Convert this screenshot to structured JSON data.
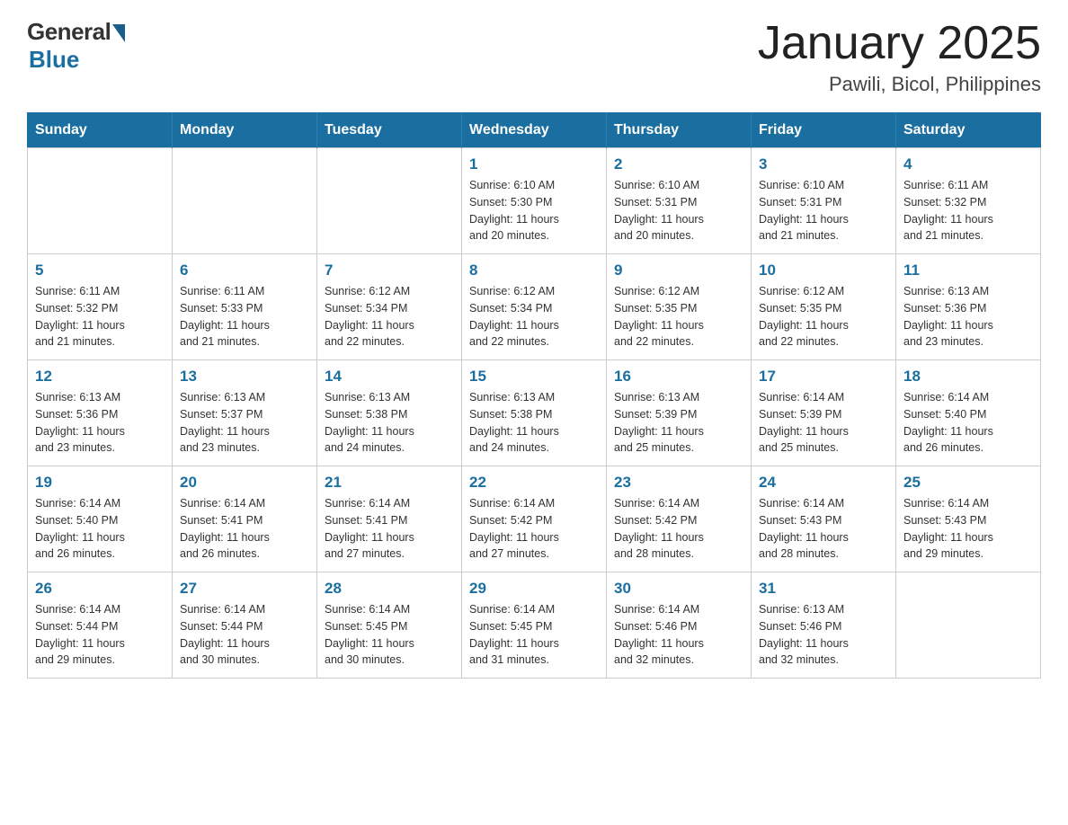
{
  "logo": {
    "general": "General",
    "blue": "Blue"
  },
  "title": "January 2025",
  "subtitle": "Pawili, Bicol, Philippines",
  "days_of_week": [
    "Sunday",
    "Monday",
    "Tuesday",
    "Wednesday",
    "Thursday",
    "Friday",
    "Saturday"
  ],
  "weeks": [
    [
      {
        "day": "",
        "info": ""
      },
      {
        "day": "",
        "info": ""
      },
      {
        "day": "",
        "info": ""
      },
      {
        "day": "1",
        "info": "Sunrise: 6:10 AM\nSunset: 5:30 PM\nDaylight: 11 hours\nand 20 minutes."
      },
      {
        "day": "2",
        "info": "Sunrise: 6:10 AM\nSunset: 5:31 PM\nDaylight: 11 hours\nand 20 minutes."
      },
      {
        "day": "3",
        "info": "Sunrise: 6:10 AM\nSunset: 5:31 PM\nDaylight: 11 hours\nand 21 minutes."
      },
      {
        "day": "4",
        "info": "Sunrise: 6:11 AM\nSunset: 5:32 PM\nDaylight: 11 hours\nand 21 minutes."
      }
    ],
    [
      {
        "day": "5",
        "info": "Sunrise: 6:11 AM\nSunset: 5:32 PM\nDaylight: 11 hours\nand 21 minutes."
      },
      {
        "day": "6",
        "info": "Sunrise: 6:11 AM\nSunset: 5:33 PM\nDaylight: 11 hours\nand 21 minutes."
      },
      {
        "day": "7",
        "info": "Sunrise: 6:12 AM\nSunset: 5:34 PM\nDaylight: 11 hours\nand 22 minutes."
      },
      {
        "day": "8",
        "info": "Sunrise: 6:12 AM\nSunset: 5:34 PM\nDaylight: 11 hours\nand 22 minutes."
      },
      {
        "day": "9",
        "info": "Sunrise: 6:12 AM\nSunset: 5:35 PM\nDaylight: 11 hours\nand 22 minutes."
      },
      {
        "day": "10",
        "info": "Sunrise: 6:12 AM\nSunset: 5:35 PM\nDaylight: 11 hours\nand 22 minutes."
      },
      {
        "day": "11",
        "info": "Sunrise: 6:13 AM\nSunset: 5:36 PM\nDaylight: 11 hours\nand 23 minutes."
      }
    ],
    [
      {
        "day": "12",
        "info": "Sunrise: 6:13 AM\nSunset: 5:36 PM\nDaylight: 11 hours\nand 23 minutes."
      },
      {
        "day": "13",
        "info": "Sunrise: 6:13 AM\nSunset: 5:37 PM\nDaylight: 11 hours\nand 23 minutes."
      },
      {
        "day": "14",
        "info": "Sunrise: 6:13 AM\nSunset: 5:38 PM\nDaylight: 11 hours\nand 24 minutes."
      },
      {
        "day": "15",
        "info": "Sunrise: 6:13 AM\nSunset: 5:38 PM\nDaylight: 11 hours\nand 24 minutes."
      },
      {
        "day": "16",
        "info": "Sunrise: 6:13 AM\nSunset: 5:39 PM\nDaylight: 11 hours\nand 25 minutes."
      },
      {
        "day": "17",
        "info": "Sunrise: 6:14 AM\nSunset: 5:39 PM\nDaylight: 11 hours\nand 25 minutes."
      },
      {
        "day": "18",
        "info": "Sunrise: 6:14 AM\nSunset: 5:40 PM\nDaylight: 11 hours\nand 26 minutes."
      }
    ],
    [
      {
        "day": "19",
        "info": "Sunrise: 6:14 AM\nSunset: 5:40 PM\nDaylight: 11 hours\nand 26 minutes."
      },
      {
        "day": "20",
        "info": "Sunrise: 6:14 AM\nSunset: 5:41 PM\nDaylight: 11 hours\nand 26 minutes."
      },
      {
        "day": "21",
        "info": "Sunrise: 6:14 AM\nSunset: 5:41 PM\nDaylight: 11 hours\nand 27 minutes."
      },
      {
        "day": "22",
        "info": "Sunrise: 6:14 AM\nSunset: 5:42 PM\nDaylight: 11 hours\nand 27 minutes."
      },
      {
        "day": "23",
        "info": "Sunrise: 6:14 AM\nSunset: 5:42 PM\nDaylight: 11 hours\nand 28 minutes."
      },
      {
        "day": "24",
        "info": "Sunrise: 6:14 AM\nSunset: 5:43 PM\nDaylight: 11 hours\nand 28 minutes."
      },
      {
        "day": "25",
        "info": "Sunrise: 6:14 AM\nSunset: 5:43 PM\nDaylight: 11 hours\nand 29 minutes."
      }
    ],
    [
      {
        "day": "26",
        "info": "Sunrise: 6:14 AM\nSunset: 5:44 PM\nDaylight: 11 hours\nand 29 minutes."
      },
      {
        "day": "27",
        "info": "Sunrise: 6:14 AM\nSunset: 5:44 PM\nDaylight: 11 hours\nand 30 minutes."
      },
      {
        "day": "28",
        "info": "Sunrise: 6:14 AM\nSunset: 5:45 PM\nDaylight: 11 hours\nand 30 minutes."
      },
      {
        "day": "29",
        "info": "Sunrise: 6:14 AM\nSunset: 5:45 PM\nDaylight: 11 hours\nand 31 minutes."
      },
      {
        "day": "30",
        "info": "Sunrise: 6:14 AM\nSunset: 5:46 PM\nDaylight: 11 hours\nand 32 minutes."
      },
      {
        "day": "31",
        "info": "Sunrise: 6:13 AM\nSunset: 5:46 PM\nDaylight: 11 hours\nand 32 minutes."
      },
      {
        "day": "",
        "info": ""
      }
    ]
  ]
}
